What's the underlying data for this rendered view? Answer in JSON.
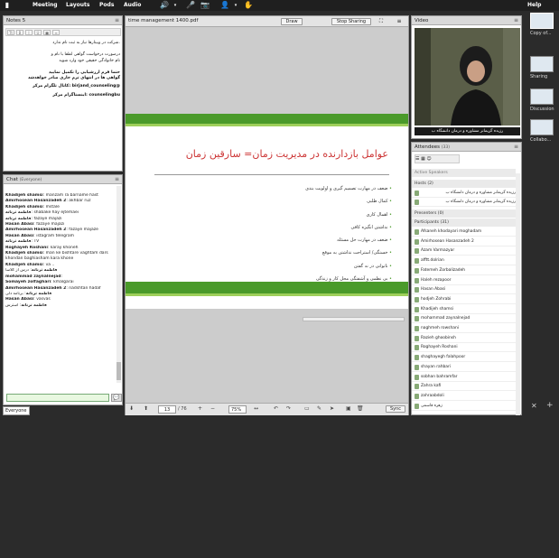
{
  "menu": {
    "items": [
      "Meeting",
      "Layouts",
      "Pods",
      "Audio"
    ],
    "help": "Help"
  },
  "notes": {
    "title": "Notes 5",
    "lines": [
      ".شرکت در وبینارها نیاز به ثبت نام ندارد",
      "درصورت درخواست گواهی لطفا با نام و",
      "نام خانوادگی حقیقی خود وارد شوید",
      "حتما فرم ارزشیابی را تکمیل نمایید",
      "گواهی ها در انتهای ترم جاری صادر خواهدشد",
      "@birjand_counseling :کانال تلگرام مرکز",
      "counselingbu :اینستاگرام مرکز"
    ]
  },
  "chat": {
    "title": "Chat",
    "scope": "(Everyone)",
    "tab": "Everyone",
    "messages": [
      {
        "name": "Khadijeh shamsi",
        "text": "manzam ra barname hast"
      },
      {
        "name": "Amirhosean Hasanzadeh 2",
        "text": "akhbar ruz"
      },
      {
        "name": "Khadijeh shamsi",
        "text": "mstale"
      },
      {
        "name": "فاطمه ترنانه",
        "text": "shabake hay ejtemaei"
      },
      {
        "name": "فاطمه ترنانه",
        "text": "fazaye majazi"
      },
      {
        "name": "Hasan Abasi",
        "text": "fazaye majazi"
      },
      {
        "name": "Amirhosean Hasanzadeh 2",
        "text": "fazaye majaze"
      },
      {
        "name": "Hasan Abasi",
        "text": "istagram telegram"
      },
      {
        "name": "فاطمه ترنانه",
        "text": "TV"
      },
      {
        "name": "Roghayeh Roshani",
        "text": "karay khoneh"
      },
      {
        "name": "Khadijeh shamsi",
        "text": "man ke bishtare vaghtam dars khondan baghiasham kara khone"
      },
      {
        "name": "Khadijeh shamsi",
        "text": "va .."
      },
      {
        "name": "فاطمه ترنانه",
        "text": "درس از کلاسا"
      },
      {
        "name": "mohammad zaynalnejad",
        "text": ""
      },
      {
        "name": "Somayeh zolfaghari",
        "text": "kmalgarai"
      },
      {
        "name": "Amirhosean Hasanzadeh 2",
        "text": "nadshtan hadaf"
      },
      {
        "name": "فاطمه ترنانه",
        "text": "برنامه دلی"
      },
      {
        "name": "Hasan Abasi",
        "text": "vasvas"
      },
      {
        "name": "فاطمه ترنانه",
        "text": "استرس"
      }
    ]
  },
  "pres": {
    "title": "time management 1400.pdf",
    "draw": "Draw",
    "stop": "Stop Sharing",
    "page": "13",
    "total": "/ 76",
    "zoom": "75%",
    "sync": "Sync",
    "slide": {
      "title": "عوامل بازدارنده در مدیریت زمان= سارقین زمان",
      "bullets": [
        "ضعف در مهارت تصمیم گیری و اولویت بندی",
        "کمال طلبی",
        "اهمال کاری",
        "نداشتن انگیزه کافی",
        "ضعف در مهارت حل مسئله",
        "خستگی/ استراحت نداشتن به موقع",
        "ناتوانی در نه گفتن",
        "بی نظمی و آشفتگی محل کار و زندگی"
      ]
    }
  },
  "video": {
    "title": "Video",
    "count": "(1)",
    "caption": "رزیده گزیمانر مشاوره و درمان دانشگاه ب"
  },
  "attendees": {
    "title": "Attendees",
    "count": "(33)",
    "active": "Active Speakers",
    "hosts": "Hosts (2)",
    "host_list": [
      "رزیده گزیمانر مشاوره و درمان دانشگاه ب",
      "رزیده گزیمانر مشاوره و درمان دانشگاه ب"
    ],
    "presenters": "Presenters (0)",
    "participants": "Participants (31)",
    "participant_list": [
      "Afsaneh khodayari moghadam",
      "Amirhosean Hasanzadeh 2",
      "Azam Varmazyar",
      "afftt.dolrian",
      "Fatemeh Zorbalizadeh",
      "Haleh rezapoor",
      "Hasan Abasi",
      "hodjeh Zohrabi",
      "Khadijeh shamsi",
      "mohammad zaynalnejad",
      "naghmeh rowshani",
      "Razieh ghoobinsh",
      "Roghayeh Roshani",
      "shaghayegh falahpoor",
      "shayan rahbari",
      "sobhan bahramfar",
      "Zahra kafi",
      "zahraabdoli",
      "زهره قاسمی"
    ]
  },
  "strip": {
    "items": [
      "Copy of...",
      "Sharing",
      "Discussion",
      "Collabo..."
    ]
  }
}
